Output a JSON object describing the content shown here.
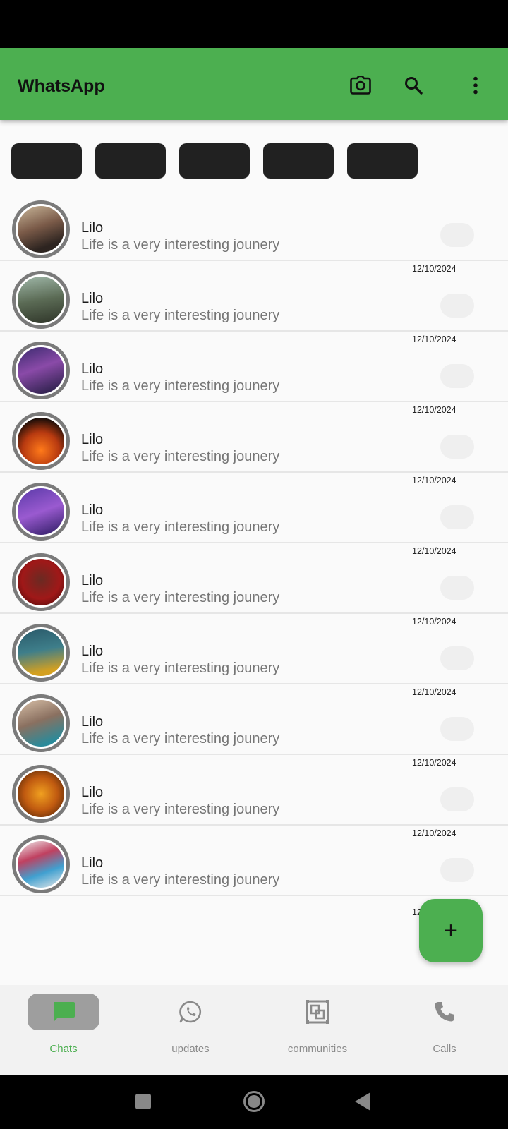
{
  "app_bar": {
    "title": "WhatsApp",
    "icons": [
      "camera-icon",
      "search-icon",
      "more-vert-icon"
    ],
    "color": "#4caf50"
  },
  "filter_chips": [
    {
      "label": ""
    },
    {
      "label": ""
    },
    {
      "label": ""
    },
    {
      "label": ""
    },
    {
      "label": ""
    }
  ],
  "chats": [
    {
      "name": "Lilo",
      "message": "Life is a very interesting jounery",
      "date": ""
    },
    {
      "name": "Lilo",
      "message": "Life is a very interesting jounery",
      "date": "12/10/2024"
    },
    {
      "name": "Lilo",
      "message": "Life is a very interesting jounery",
      "date": "12/10/2024"
    },
    {
      "name": "Lilo",
      "message": "Life is a very interesting jounery",
      "date": "12/10/2024"
    },
    {
      "name": "Lilo",
      "message": "Life is a very interesting jounery",
      "date": "12/10/2024"
    },
    {
      "name": "Lilo",
      "message": "Life is a very interesting jounery",
      "date": "12/10/2024"
    },
    {
      "name": "Lilo",
      "message": "Life is a very interesting jounery",
      "date": "12/10/2024"
    },
    {
      "name": "Lilo",
      "message": "Life is a very interesting jounery",
      "date": "12/10/2024"
    },
    {
      "name": "Lilo",
      "message": "Life is a very interesting jounery",
      "date": "12/10/2024"
    },
    {
      "name": "Lilo",
      "message": "Life is a very interesting jounery",
      "date": "12/10/2024"
    }
  ],
  "date_peek": "12",
  "fab": {
    "label": "+",
    "icon": "add-icon"
  },
  "bottom_nav": [
    {
      "label": "Chats",
      "icon": "chat-icon",
      "active": true
    },
    {
      "label": "updates",
      "icon": "whatsapp-status-icon",
      "active": false
    },
    {
      "label": "communities",
      "icon": "communities-icon",
      "active": false
    },
    {
      "label": "Calls",
      "icon": "phone-icon",
      "active": false
    }
  ],
  "colors": {
    "accent": "#4caf50",
    "chip": "#212121",
    "inactive": "#8a8a8a"
  }
}
